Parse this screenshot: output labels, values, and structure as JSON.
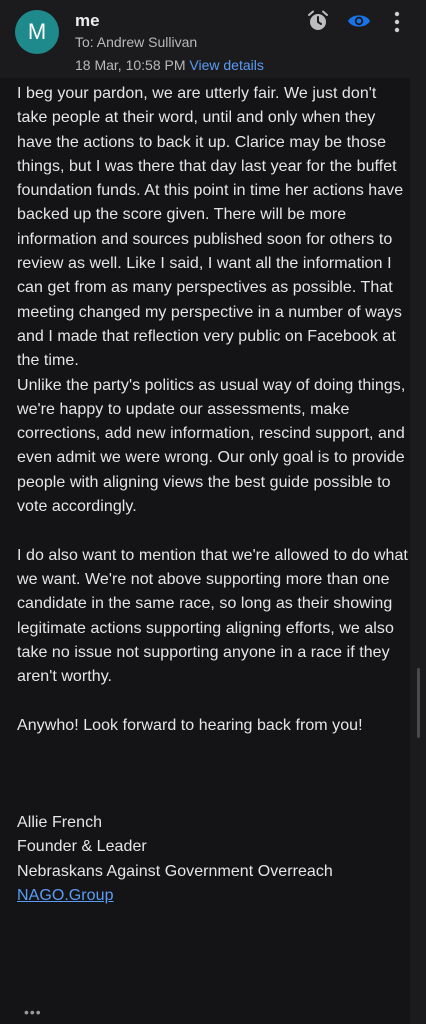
{
  "header": {
    "avatar_letter": "M",
    "sender": "me",
    "to": "To: Andrew Sullivan",
    "date": "18 Mar, 10:58 PM",
    "details_link": "View details",
    "icons": [
      "snooze-icon",
      "eye-icon",
      "more-vert-icon"
    ],
    "avatar_color": "#1f8a8c",
    "accent_color": "#5b9cf5"
  },
  "message": {
    "p1": "I beg your pardon, we are utterly fair. We just don't take people at their word, until and only when they have the actions to back it up. Clarice may be those things, but I was there that day last year for the buffet foundation funds. At this point in time her actions have backed up the score given. There will be more information and sources published soon for others to review as well. Like I said, I want all the information I can get from as many perspectives as possible. That meeting changed my perspective in a number of ways and I made that reflection very public on Facebook at the time.",
    "p2": "Unlike the party's politics as usual way of doing things, we're happy to update our assessments, make corrections, add new information, rescind support, and even admit we were wrong. Our only goal is to provide people with aligning views the best guide possible to vote accordingly.",
    "p3": "I do also want to mention that we're allowed to do what we want. We're not above supporting more than one candidate in the same race, so long as their showing legitimate actions supporting aligning efforts, we also take no issue not supporting anyone in a race if they aren't worthy.",
    "p4": "Anywho! Look forward to hearing back from you!",
    "signature": {
      "name": "Allie French",
      "title": "Founder & Leader",
      "org": "Nebraskans Against Government Overreach",
      "link": "NAGO.Group"
    },
    "trimmed_indicator": "•••"
  }
}
